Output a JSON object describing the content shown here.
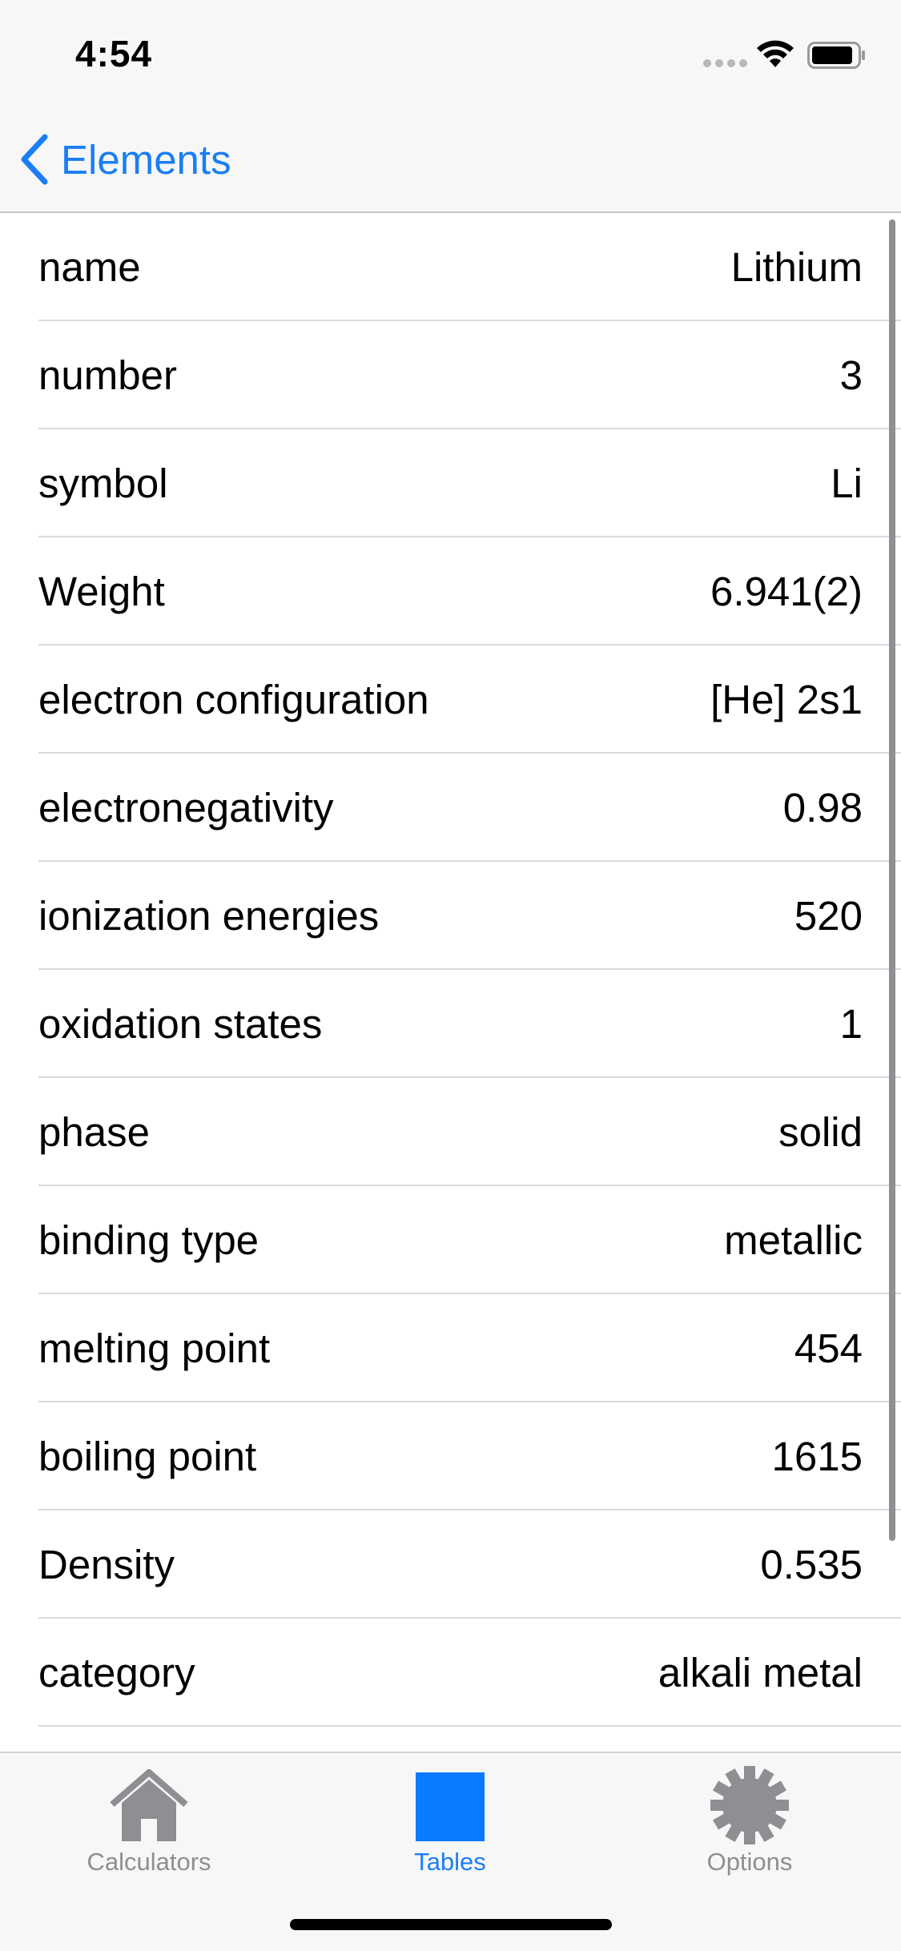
{
  "status_bar": {
    "time": "4:54"
  },
  "nav": {
    "back_label": "Elements"
  },
  "rows": [
    {
      "label": "name",
      "value": "Lithium"
    },
    {
      "label": "number",
      "value": "3"
    },
    {
      "label": "symbol",
      "value": "Li"
    },
    {
      "label": "Weight",
      "value": "6.941(2)"
    },
    {
      "label": "electron configuration",
      "value": "[He] 2s1"
    },
    {
      "label": "electronegativity",
      "value": "0.98"
    },
    {
      "label": "ionization energies",
      "value": "520"
    },
    {
      "label": "oxidation states",
      "value": "1"
    },
    {
      "label": "phase",
      "value": "solid"
    },
    {
      "label": "binding type",
      "value": "metallic"
    },
    {
      "label": "melting point",
      "value": "454"
    },
    {
      "label": "boiling point",
      "value": "1615"
    },
    {
      "label": "Density",
      "value": "0.535"
    },
    {
      "label": "category",
      "value": "alkali metal"
    }
  ],
  "tabs": [
    {
      "label": "Calculators",
      "icon": "house-icon",
      "active": false
    },
    {
      "label": "Tables",
      "icon": "square-icon",
      "active": true
    },
    {
      "label": "Options",
      "icon": "gear-icon",
      "active": false
    }
  ],
  "colors": {
    "accent": "#1a7ef5",
    "inactive_tab": "#8e8e93",
    "bar_background": "#f7f7f7",
    "separator": "#d9d9dd"
  }
}
